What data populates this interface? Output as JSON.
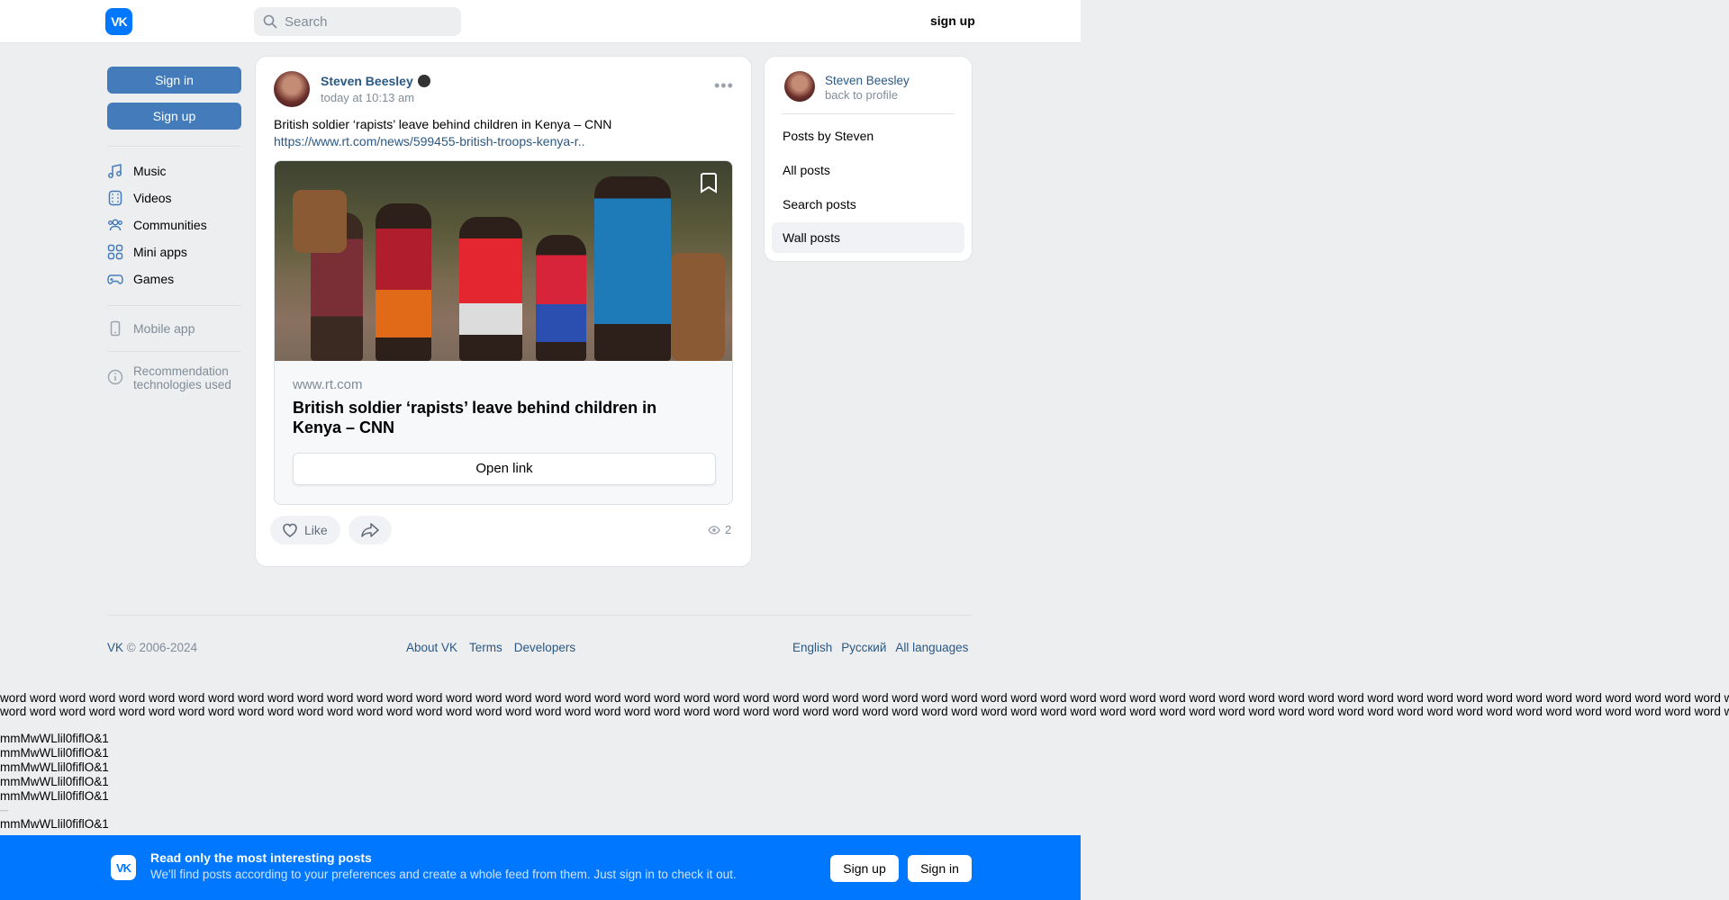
{
  "header": {
    "logo_text": "VK",
    "search_placeholder": "Search",
    "signup_label": "sign up"
  },
  "left_nav": {
    "signin_label": "Sign in",
    "signup_label": "Sign up",
    "items": [
      {
        "label": "Music",
        "icon": "music-icon"
      },
      {
        "label": "Videos",
        "icon": "videos-icon"
      },
      {
        "label": "Communities",
        "icon": "communities-icon"
      },
      {
        "label": "Mini apps",
        "icon": "mini-apps-icon"
      },
      {
        "label": "Games",
        "icon": "games-icon"
      }
    ],
    "mobile_app": "Mobile app",
    "recommendation_line1": "Recommendation",
    "recommendation_line2": "technologies used"
  },
  "post": {
    "author": "Steven Beesley",
    "time": "today at 10:13 am",
    "text": "British soldier ‘rapists’ leave behind children in Kenya – CNN",
    "link": "https://www.rt.com/news/599455-british-troops-kenya-r..",
    "card": {
      "domain": "www.rt.com",
      "title": "British soldier ‘rapists’ leave behind children in Kenya – CNN",
      "open_link_label": "Open link"
    },
    "like_label": "Like",
    "views": "2"
  },
  "right_panel": {
    "name": "Steven Beesley",
    "back_label": "back to profile",
    "items": [
      {
        "label": "Posts by Steven"
      },
      {
        "label": "All posts"
      },
      {
        "label": "Search posts"
      },
      {
        "label": "Wall posts"
      }
    ]
  },
  "footer": {
    "brand": "VK",
    "copyright": " © 2006-2024",
    "about": "About VK",
    "terms": "Terms",
    "developers": "Developers",
    "english": "English",
    "russian": "Русский",
    "all_languages": "All languages"
  },
  "filler": {
    "words_line": "word word word word word word word word word word word word word word word word word word word word word word word word word word word word word word word word word word word word word word word word word word word word word word word word word word word word word word word word word word word",
    "mline": "mmMwWLlil0fiflO&1",
    "dash": "—"
  },
  "banner": {
    "logo_text": "VK",
    "title": "Read only the most interesting posts",
    "subtitle": "We'll find posts according to your preferences and create a whole feed from them. Just sign in to check it out.",
    "signup_label": "Sign up",
    "signin_label": "Sign in"
  },
  "colors": {
    "accent": "#0077ff",
    "link": "#2a5885",
    "button": "#447bba",
    "background": "#edeef0"
  }
}
